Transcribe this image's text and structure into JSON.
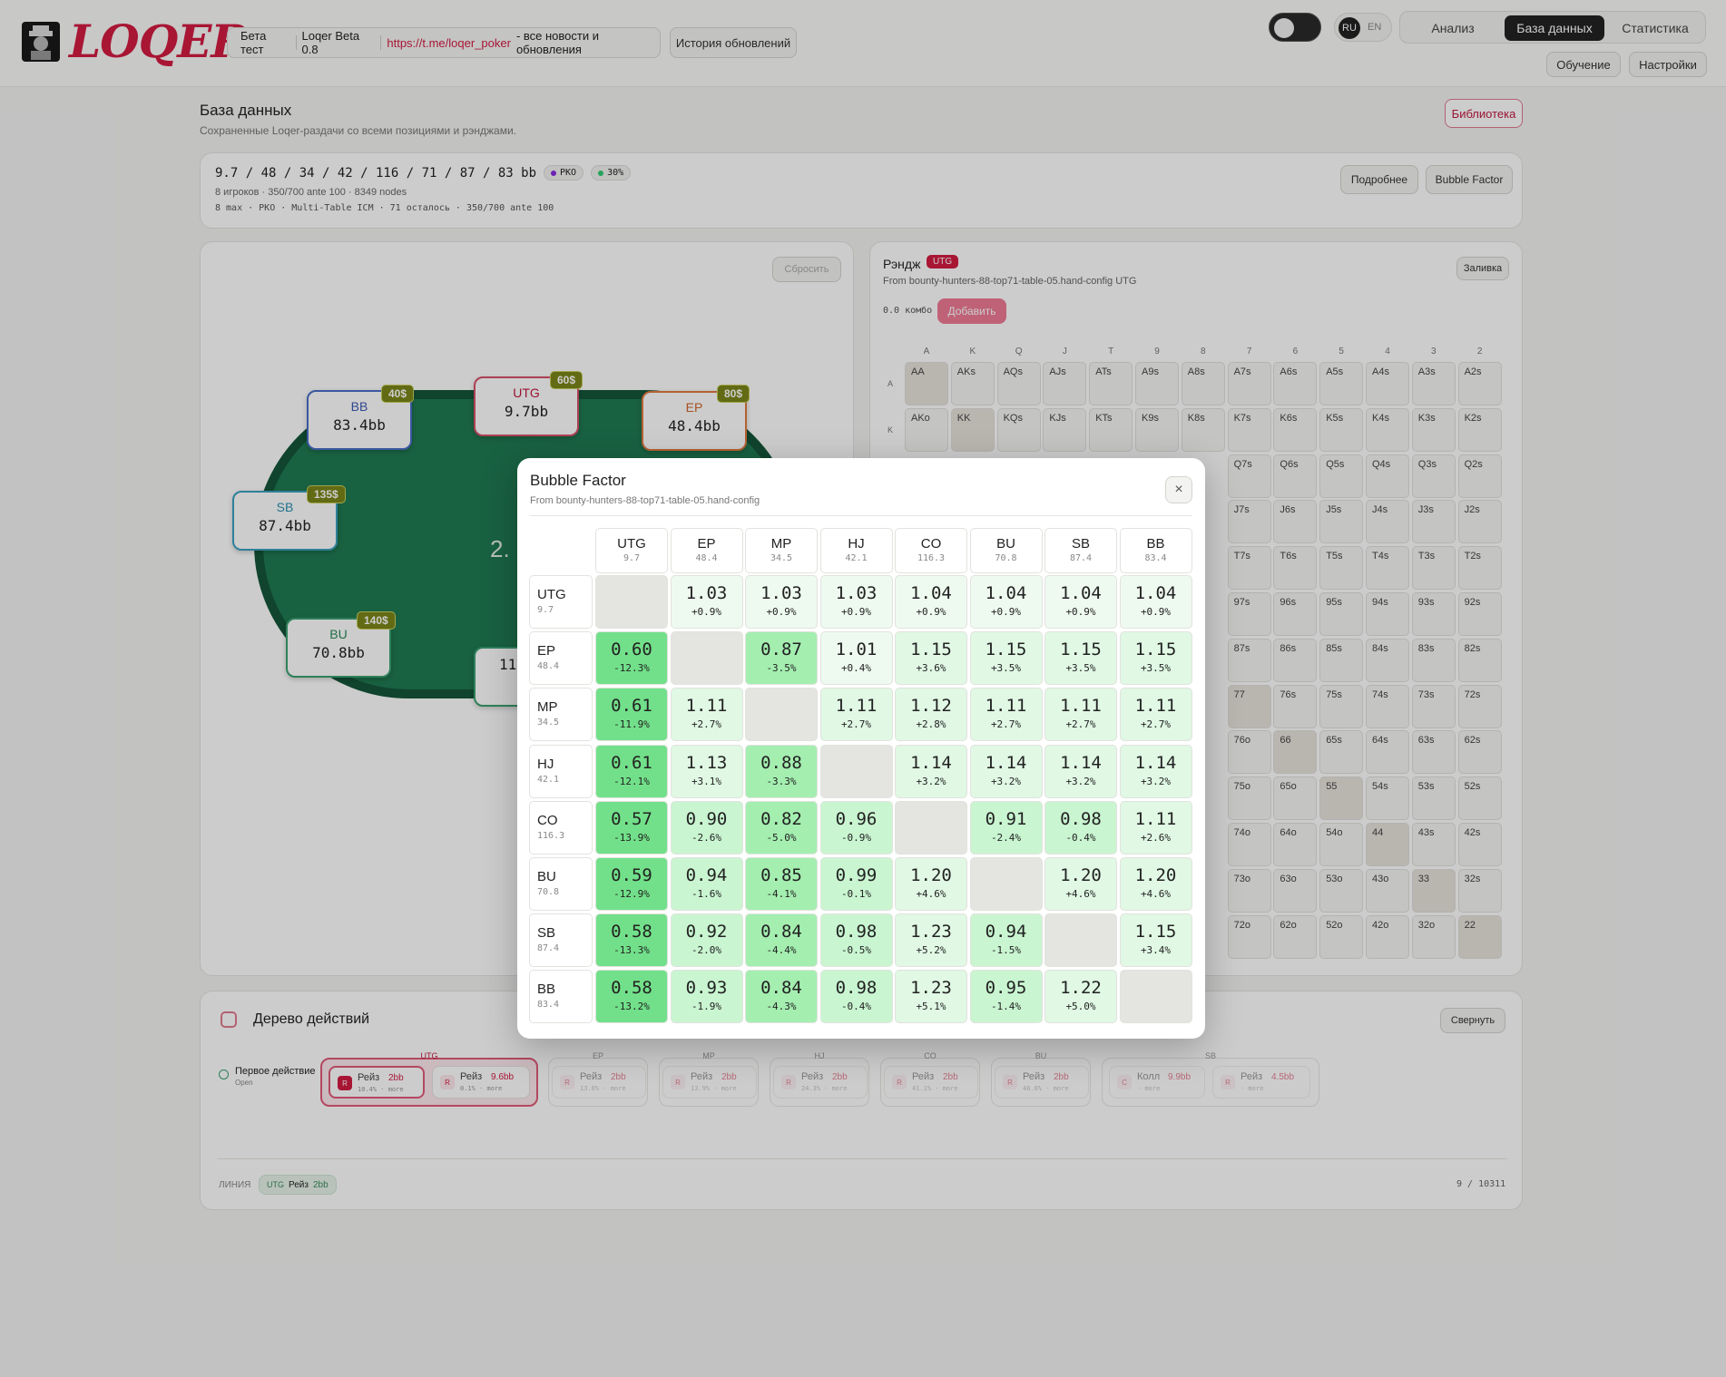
{
  "header": {
    "beta_label": "Бета тест",
    "version": "Loqer Beta 0.8",
    "link": "https://t.me/loqer_poker",
    "link_suffix": "- все новости и обновления",
    "history_button": "История обновлений",
    "lang_ru": "RU",
    "lang_en": "EN",
    "nav": [
      "Анализ",
      "База данных",
      "Статистика"
    ],
    "learn_button": "Обучение",
    "settings_button": "Настройки"
  },
  "page": {
    "title": "База данных",
    "subtitle": "Сохраненные Loqer-раздачи со всеми позициями и рэнджами.",
    "library_button": "Библиотека"
  },
  "hand": {
    "stacks": "9.7 / 48 / 34 / 42 / 116 / 71 / 87 / 83 bb",
    "badge_pko": "PKO",
    "badge_pct": "30%",
    "info1": "8 игроков · 350/700 ante 100 · 8349 nodes",
    "info2": "8 max · PKO · Multi-Table ICM · 71 осталось · 350/700 ante 100",
    "details_button": "Подробнее",
    "bubble_button": "Bubble Factor"
  },
  "table_panel": {
    "reset_button": "Сбросить",
    "pot": "2.",
    "seats": [
      {
        "pos": "BB",
        "stack": "83.4bb",
        "bounty": "40$"
      },
      {
        "pos": "UTG",
        "stack": "9.7bb",
        "bounty": "60$"
      },
      {
        "pos": "EP",
        "stack": "48.4bb",
        "bounty": "80$"
      },
      {
        "pos": "SB",
        "stack": "87.4bb",
        "bounty": "135$"
      },
      {
        "pos": "BU",
        "stack": "70.8bb",
        "bounty": "140$"
      },
      {
        "pos": "",
        "stack": "11",
        "bounty": ""
      }
    ]
  },
  "range_panel": {
    "title": "Рэндж",
    "pos_badge": "UTG",
    "source": "From bounty-hunters-88-top71-table-05.hand-config UTG",
    "combo": "0.0 комбо",
    "add_button": "Добавить",
    "fill_button": "Заливка",
    "cols": [
      "A",
      "K",
      "Q",
      "J",
      "T",
      "9",
      "8",
      "7",
      "6",
      "5",
      "4",
      "3",
      "2"
    ],
    "row_labels": [
      "A",
      "K"
    ],
    "rows": [
      [
        "AA",
        "AKs",
        "AQs",
        "AJs",
        "ATs",
        "A9s",
        "A8s",
        "A7s",
        "A6s",
        "A5s",
        "A4s",
        "A3s",
        "A2s"
      ],
      [
        "AKo",
        "KK",
        "KQs",
        "KJs",
        "KTs",
        "K9s",
        "K8s",
        "K7s",
        "K6s",
        "K5s",
        "K4s",
        "K3s",
        "K2s"
      ],
      [
        "",
        "",
        "",
        "",
        "",
        "",
        "",
        "Q7s",
        "Q6s",
        "Q5s",
        "Q4s",
        "Q3s",
        "Q2s"
      ],
      [
        "",
        "",
        "",
        "",
        "",
        "",
        "",
        "J7s",
        "J6s",
        "J5s",
        "J4s",
        "J3s",
        "J2s"
      ],
      [
        "",
        "",
        "",
        "",
        "",
        "",
        "",
        "T7s",
        "T6s",
        "T5s",
        "T4s",
        "T3s",
        "T2s"
      ],
      [
        "",
        "",
        "",
        "",
        "",
        "",
        "",
        "97s",
        "96s",
        "95s",
        "94s",
        "93s",
        "92s"
      ],
      [
        "",
        "",
        "",
        "",
        "",
        "",
        "",
        "87s",
        "86s",
        "85s",
        "84s",
        "83s",
        "82s"
      ],
      [
        "",
        "",
        "",
        "",
        "",
        "",
        "",
        "77",
        "76s",
        "75s",
        "74s",
        "73s",
        "72s"
      ],
      [
        "",
        "",
        "",
        "",
        "",
        "",
        "",
        "76o",
        "66",
        "65s",
        "64s",
        "63s",
        "62s"
      ],
      [
        "",
        "",
        "",
        "",
        "",
        "",
        "",
        "75o",
        "65o",
        "55",
        "54s",
        "53s",
        "52s"
      ],
      [
        "",
        "",
        "",
        "",
        "",
        "",
        "",
        "74o",
        "64o",
        "54o",
        "44",
        "43s",
        "42s"
      ],
      [
        "",
        "",
        "",
        "",
        "",
        "",
        "",
        "73o",
        "63o",
        "53o",
        "43o",
        "33",
        "32s"
      ],
      [
        "",
        "",
        "",
        "",
        "",
        "",
        "",
        "72o",
        "62o",
        "52o",
        "42o",
        "32o",
        "22"
      ]
    ]
  },
  "tree": {
    "title": "Дерево действий",
    "collapse_button": "Свернуть",
    "first_action": "Первое действие",
    "first_action_sub": "Open",
    "groups": [
      {
        "label": "UTG",
        "items": [
          {
            "badge": "R",
            "name": "Рейз",
            "size": "2bb",
            "sub": "10.4% · more"
          },
          {
            "badge": "R",
            "name": "Рейз",
            "size": "9.6bb",
            "sub": "0.1% · more"
          }
        ]
      },
      {
        "label": "EP",
        "items": [
          {
            "badge": "R",
            "name": "Рейз",
            "size": "2bb",
            "sub": "13.6% · more"
          }
        ]
      },
      {
        "label": "MP",
        "items": [
          {
            "badge": "R",
            "name": "Рейз",
            "size": "2bb",
            "sub": "13.9% · more"
          }
        ]
      },
      {
        "label": "HJ",
        "items": [
          {
            "badge": "R",
            "name": "Рейз",
            "size": "2bb",
            "sub": "24.3% · more"
          }
        ]
      },
      {
        "label": "CO",
        "items": [
          {
            "badge": "R",
            "name": "Рейз",
            "size": "2bb",
            "sub": "41.1% · more"
          }
        ]
      },
      {
        "label": "BU",
        "items": [
          {
            "badge": "R",
            "name": "Рейз",
            "size": "2bb",
            "sub": "46.6% · more"
          }
        ]
      },
      {
        "label": "SB",
        "items": [
          {
            "badge": "C",
            "name": "Колл",
            "size": "9.9bb",
            "sub": "· more"
          },
          {
            "badge": "R",
            "name": "Рейз",
            "size": "4.5bb",
            "sub": "· more"
          }
        ]
      }
    ],
    "line_label": "ЛИНИЯ",
    "line_pos": "UTG",
    "line_action": "Рейз",
    "line_size": "2bb",
    "counter": "9 / 10311"
  },
  "modal": {
    "title": "Bubble Factor",
    "source": "From bounty-hunters-88-top71-table-05.hand-config",
    "close": "×",
    "positions": [
      {
        "pos": "UTG",
        "stack": "9.7"
      },
      {
        "pos": "EP",
        "stack": "48.4"
      },
      {
        "pos": "MP",
        "stack": "34.5"
      },
      {
        "pos": "HJ",
        "stack": "42.1"
      },
      {
        "pos": "CO",
        "stack": "116.3"
      },
      {
        "pos": "BU",
        "stack": "70.8"
      },
      {
        "pos": "SB",
        "stack": "87.4"
      },
      {
        "pos": "BB",
        "stack": "83.4"
      }
    ],
    "matrix": [
      [
        null,
        [
          "1.03",
          "+0.9%"
        ],
        [
          "1.03",
          "+0.9%"
        ],
        [
          "1.03",
          "+0.9%"
        ],
        [
          "1.04",
          "+0.9%"
        ],
        [
          "1.04",
          "+0.9%"
        ],
        [
          "1.04",
          "+0.9%"
        ],
        [
          "1.04",
          "+0.9%"
        ]
      ],
      [
        [
          "0.60",
          "-12.3%"
        ],
        null,
        [
          "0.87",
          "-3.5%"
        ],
        [
          "1.01",
          "+0.4%"
        ],
        [
          "1.15",
          "+3.6%"
        ],
        [
          "1.15",
          "+3.5%"
        ],
        [
          "1.15",
          "+3.5%"
        ],
        [
          "1.15",
          "+3.5%"
        ]
      ],
      [
        [
          "0.61",
          "-11.9%"
        ],
        [
          "1.11",
          "+2.7%"
        ],
        null,
        [
          "1.11",
          "+2.7%"
        ],
        [
          "1.12",
          "+2.8%"
        ],
        [
          "1.11",
          "+2.7%"
        ],
        [
          "1.11",
          "+2.7%"
        ],
        [
          "1.11",
          "+2.7%"
        ]
      ],
      [
        [
          "0.61",
          "-12.1%"
        ],
        [
          "1.13",
          "+3.1%"
        ],
        [
          "0.88",
          "-3.3%"
        ],
        null,
        [
          "1.14",
          "+3.2%"
        ],
        [
          "1.14",
          "+3.2%"
        ],
        [
          "1.14",
          "+3.2%"
        ],
        [
          "1.14",
          "+3.2%"
        ]
      ],
      [
        [
          "0.57",
          "-13.9%"
        ],
        [
          "0.90",
          "-2.6%"
        ],
        [
          "0.82",
          "-5.0%"
        ],
        [
          "0.96",
          "-0.9%"
        ],
        null,
        [
          "0.91",
          "-2.4%"
        ],
        [
          "0.98",
          "-0.4%"
        ],
        [
          "1.11",
          "+2.6%"
        ]
      ],
      [
        [
          "0.59",
          "-12.9%"
        ],
        [
          "0.94",
          "-1.6%"
        ],
        [
          "0.85",
          "-4.1%"
        ],
        [
          "0.99",
          "-0.1%"
        ],
        [
          "1.20",
          "+4.6%"
        ],
        null,
        [
          "1.20",
          "+4.6%"
        ],
        [
          "1.20",
          "+4.6%"
        ]
      ],
      [
        [
          "0.58",
          "-13.3%"
        ],
        [
          "0.92",
          "-2.0%"
        ],
        [
          "0.84",
          "-4.4%"
        ],
        [
          "0.98",
          "-0.5%"
        ],
        [
          "1.23",
          "+5.2%"
        ],
        [
          "0.94",
          "-1.5%"
        ],
        null,
        [
          "1.15",
          "+3.4%"
        ]
      ],
      [
        [
          "0.58",
          "-13.2%"
        ],
        [
          "0.93",
          "-1.9%"
        ],
        [
          "0.84",
          "-4.3%"
        ],
        [
          "0.98",
          "-0.4%"
        ],
        [
          "1.23",
          "+5.1%"
        ],
        [
          "0.95",
          "-1.4%"
        ],
        [
          "1.22",
          "+5.0%"
        ],
        null
      ]
    ]
  }
}
